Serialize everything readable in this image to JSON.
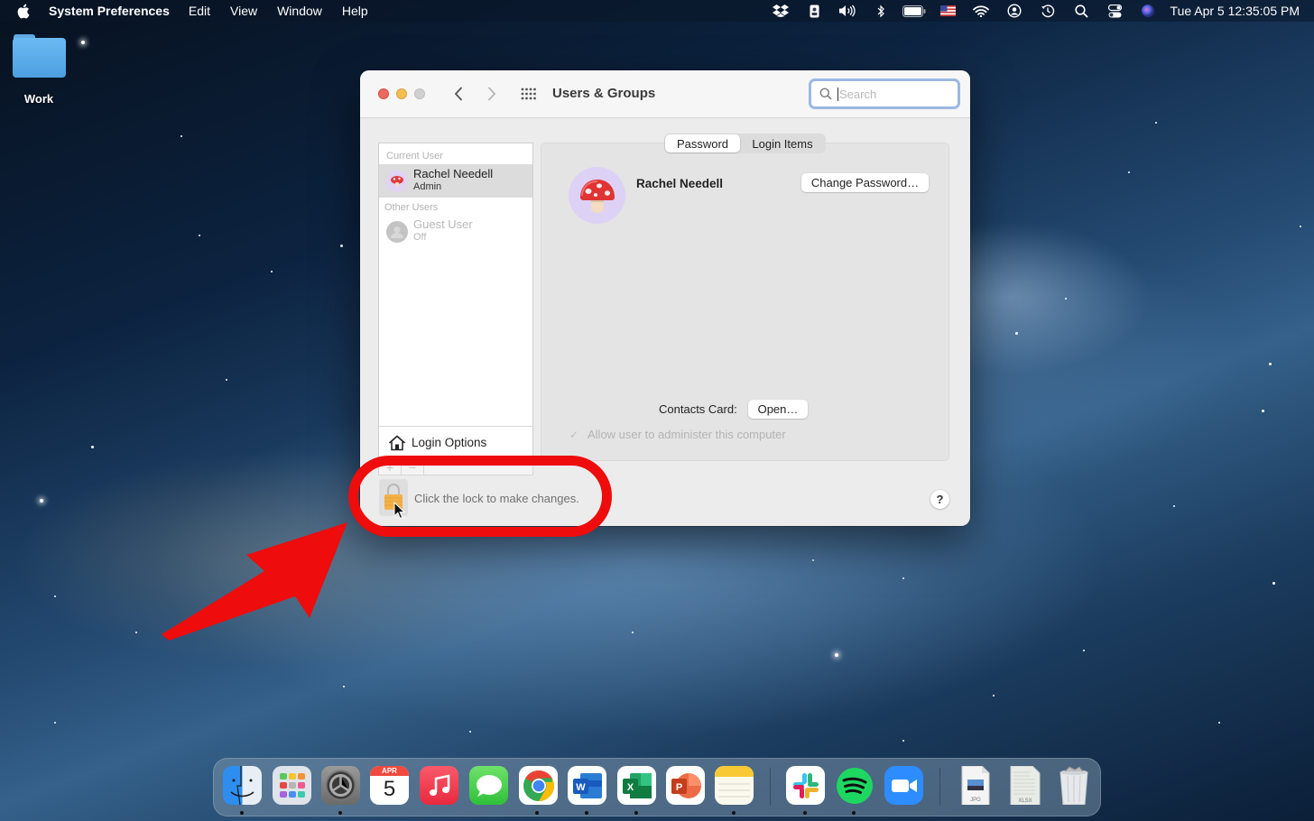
{
  "menubar": {
    "apple_icon": "apple-logo",
    "app_name": "System Preferences",
    "menus": [
      "Edit",
      "View",
      "Window",
      "Help"
    ],
    "status_icons": [
      "dropbox-icon",
      "contact-card-icon",
      "volume-icon",
      "bluetooth-icon",
      "battery-icon",
      "us-flag-icon",
      "wifi-icon",
      "user-account-icon",
      "time-machine-icon",
      "spotlight-search-icon",
      "control-center-icon",
      "siri-icon"
    ],
    "clock": "Tue Apr 5  12:35:05 PM"
  },
  "desktop": {
    "folder_label": "Work"
  },
  "window": {
    "title": "Users & Groups",
    "search_placeholder": "Search",
    "sidebar": {
      "current_user_header": "Current User",
      "current_user": {
        "name": "Rachel Needell",
        "role": "Admin"
      },
      "other_users_header": "Other Users",
      "other_users": [
        {
          "name": "Guest User",
          "status": "Off"
        }
      ],
      "login_options_label": "Login Options",
      "add_label": "+",
      "remove_label": "−"
    },
    "tabs": [
      {
        "label": "Password",
        "active": true
      },
      {
        "label": "Login Items",
        "active": false
      }
    ],
    "detail": {
      "user_name": "Rachel Needell",
      "change_password_label": "Change Password…",
      "contacts_card_label": "Contacts Card:",
      "open_label": "Open…",
      "admin_checkbox_label": "Allow user to administer this computer",
      "admin_checked": true
    },
    "lock_text": "Click the lock to make changes.",
    "help_label": "?"
  },
  "dock": {
    "apps": [
      {
        "name": "Finder",
        "running": true
      },
      {
        "name": "Launchpad",
        "running": false
      },
      {
        "name": "System Preferences",
        "running": true
      },
      {
        "name": "Calendar",
        "running": false,
        "month": "APR",
        "day": "5"
      },
      {
        "name": "Music",
        "running": false
      },
      {
        "name": "Messages",
        "running": false
      },
      {
        "name": "Google Chrome",
        "running": true
      },
      {
        "name": "Microsoft Word",
        "running": true
      },
      {
        "name": "Microsoft Excel",
        "running": true
      },
      {
        "name": "Microsoft PowerPoint",
        "running": false
      },
      {
        "name": "Notes",
        "running": true
      },
      {
        "name": "Slack",
        "running": true
      },
      {
        "name": "Spotify",
        "running": true
      },
      {
        "name": "Zoom",
        "running": false
      }
    ],
    "documents": [
      {
        "name": "JPG document",
        "ext": "JPG"
      },
      {
        "name": "XLSX document",
        "ext": "XLSX"
      }
    ],
    "trash_label": "Trash"
  },
  "colors": {
    "annotation_red": "#ee0c0c",
    "close": "#ed6a5e",
    "minimize": "#f5bf4f",
    "search_focus": "#9cb7e2"
  }
}
